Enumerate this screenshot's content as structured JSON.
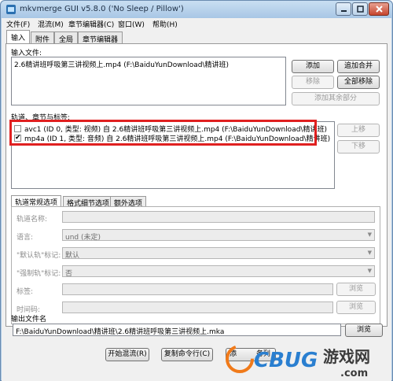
{
  "window": {
    "title": "mkvmerge GUI v5.8.0 ('No Sleep / Pillow')"
  },
  "menu": [
    "文件(F)",
    "混流(M)",
    "章节编辑器(C)",
    "窗口(W)",
    "帮助(H)"
  ],
  "tabs": [
    "输入",
    "附件",
    "全局",
    "章节编辑器"
  ],
  "input": {
    "section_label": "输入文件:",
    "files": [
      "2.6精讲班呼吸第三讲视频上.mp4 (F:\\BaiduYunDownload\\精讲班)"
    ],
    "buttons": {
      "add": "添加",
      "append": "追加合并",
      "remove": "移除",
      "remove_all": "全部移除",
      "add_other": "添加其余部分"
    }
  },
  "tracks": {
    "section_label": "轨道、章节与标签:",
    "items": [
      {
        "label": "avc1 (ID 0, 类型: 视频) 自 2.6精讲班呼吸第三讲视频上.mp4 (F:\\BaiduYunDownload\\精讲班)",
        "checked": false
      },
      {
        "label": "mp4a (ID 1, 类型: 音频) 自 2.6精讲班呼吸第三讲视频上.mp4 (F:\\BaiduYunDownload\\精讲班)",
        "checked": true
      }
    ],
    "buttons": {
      "up": "上移",
      "down": "下移"
    }
  },
  "options": {
    "tabs": [
      "轨道常规选项",
      "格式细节选项",
      "额外选项"
    ],
    "track_name_label": "轨道名称:",
    "language_label": "语言:",
    "language_value": "und (未定)",
    "default_label": "\"默认轨\"标记:",
    "default_value": "默认",
    "forced_label": "\"强制轨\"标记:",
    "forced_value": "否",
    "tags_label": "标签:",
    "timecodes_label": "时间码:",
    "browse": "浏览"
  },
  "output": {
    "label": "输出文件名",
    "value": "F:\\BaiduYunDownload\\精讲班\\2.6精讲班呼吸第三讲视频上.mka",
    "browse": "浏览"
  },
  "footer": {
    "start_mux": "开始混流(R)",
    "copy_cmd": "复制命令行(C)",
    "add_job_partial": "添",
    "add_job_partial2": "务列"
  },
  "watermark": {
    "brand": "UCBUG",
    "game": "游戏网",
    "domain": ".com"
  },
  "colors": {
    "highlight": "#e02020",
    "brand_orange": "#f07a1a",
    "brand_blue": "#2a7fd0"
  }
}
